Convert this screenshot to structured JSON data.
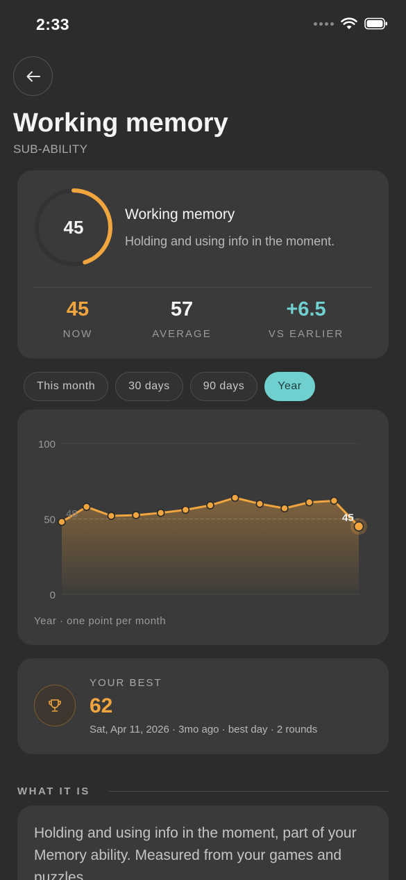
{
  "status": {
    "time": "2:33"
  },
  "header": {
    "title": "Working memory",
    "subtitle": "SUB-ABILITY"
  },
  "summary": {
    "ring_value": "45",
    "ring_fraction": 0.45,
    "name": "Working memory",
    "description": "Holding and using info in the moment.",
    "stats": [
      {
        "value": "45",
        "label": "NOW",
        "color": "#f0a53f"
      },
      {
        "value": "57",
        "label": "AVERAGE",
        "color": "#f4f4f4"
      },
      {
        "value": "+6.5",
        "label": "VS EARLIER",
        "color": "#6fd0cf"
      }
    ]
  },
  "tabs": [
    "This month",
    "30 days",
    "90 days",
    "Year"
  ],
  "active_tab": "Year",
  "chart_data": {
    "type": "area",
    "ylim": [
      0,
      100
    ],
    "yticks": [
      "100",
      "50",
      "0"
    ],
    "values": [
      48,
      58,
      52,
      52.5,
      54,
      56,
      59,
      64,
      60,
      57,
      61,
      62,
      45
    ],
    "start_label": "48",
    "end_label": "45",
    "reference_line": 50,
    "caption": "Year · one point per month",
    "line_color": "#f0a53f"
  },
  "best": {
    "label": "YOUR BEST",
    "value": "62",
    "meta": "Sat, Apr 11, 2026 · 3mo ago · best day · 2 rounds"
  },
  "about": {
    "heading": "WHAT IT IS",
    "text": "Holding and using info in the moment, part of your Memory ability. Measured from your games and puzzles."
  }
}
